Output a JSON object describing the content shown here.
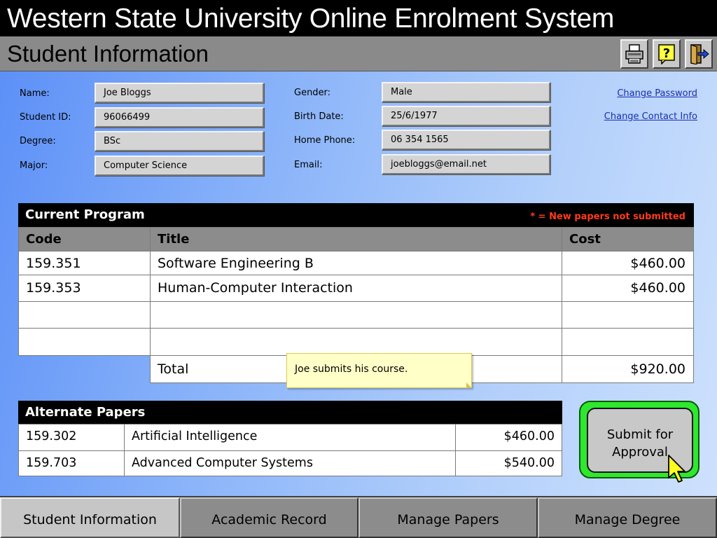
{
  "app": {
    "title": "Western State University Online Enrolment System",
    "page_title": "Student Information"
  },
  "toolbar": {
    "icons": [
      "printer-icon",
      "help-icon",
      "exit-door-icon"
    ]
  },
  "student": {
    "name_label": "Name:",
    "name": "Joe Bloggs",
    "id_label": "Student ID:",
    "id": "96066499",
    "degree_label": "Degree:",
    "degree": "BSc",
    "major_label": "Major:",
    "major": "Computer Science",
    "gender_label": "Gender:",
    "gender": "Male",
    "birth_label": "Birth Date:",
    "birth": "25/6/1977",
    "phone_label": "Home Phone:",
    "phone": "06 354 1565",
    "email_label": "Email:",
    "email": "joebloggs@email.net"
  },
  "links": {
    "change_password": "Change Password",
    "change_contact": "Change Contact Info"
  },
  "current_program": {
    "title": "Current Program",
    "note": "* = New papers not submitted",
    "columns": [
      "Code",
      "Title",
      "Cost"
    ],
    "rows": [
      {
        "code": "159.351",
        "title": "Software Engineering B",
        "cost": "$460.00"
      },
      {
        "code": "159.353",
        "title": "Human-Computer Interaction",
        "cost": "$460.00"
      },
      {
        "code": "",
        "title": "",
        "cost": ""
      },
      {
        "code": "",
        "title": "",
        "cost": ""
      }
    ],
    "total_label": "Total",
    "total": "$920.00"
  },
  "annotation": "Joe submits his course.",
  "alternate_papers": {
    "title": "Alternate Papers",
    "rows": [
      {
        "code": "159.302",
        "title": "Artificial Intelligence",
        "cost": "$460.00"
      },
      {
        "code": "159.703",
        "title": "Advanced Computer Systems",
        "cost": "$540.00"
      }
    ]
  },
  "submit": {
    "line1": "Submit for",
    "line2": "Approval"
  },
  "tabs": [
    "Student Information",
    "Academic Record",
    "Manage Papers",
    "Manage Degree"
  ],
  "active_tab": "Student Information",
  "colors": {
    "title_bar": "#000000",
    "sub_bar": "#8a8a8a",
    "submit_highlight": "#2ee82e",
    "note_text": "#ff3c1a",
    "link": "#1a2fb0"
  }
}
